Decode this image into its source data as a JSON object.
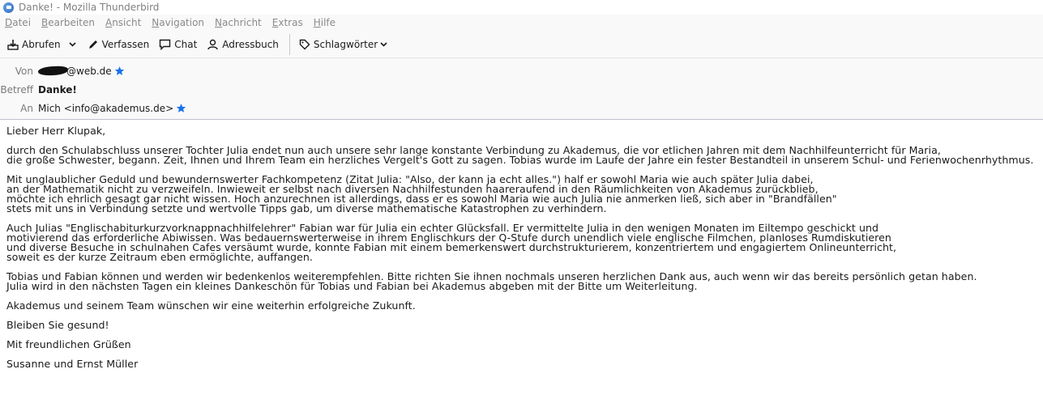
{
  "window": {
    "title": "Danke! - Mozilla Thunderbird"
  },
  "menu": {
    "items": [
      "Datei",
      "Bearbeiten",
      "Ansicht",
      "Navigation",
      "Nachricht",
      "Extras",
      "Hilfe"
    ]
  },
  "toolbar": {
    "get_mail_label": "Abrufen",
    "compose_label": "Verfassen",
    "chat_label": "Chat",
    "addressbook_label": "Adressbuch",
    "tags_label": "Schlagwörter"
  },
  "header": {
    "from_label": "Von",
    "from_value_visible": "@web.de",
    "subject_label": "Betreff",
    "subject_value": "Danke!",
    "to_label": "An",
    "to_value": "Mich <info@akademus.de>"
  },
  "colors": {
    "star": "#1a73e8",
    "text": "#1a1a1a",
    "label": "#7a7a7a"
  },
  "body": {
    "paragraphs": [
      [
        "Lieber Herr Klupak,"
      ],
      [
        "durch den Schulabschluss unserer Tochter Julia endet nun auch unsere sehr lange konstante Verbindung zu Akademus, die vor etlichen Jahren mit dem Nachhilfeunterricht für Maria,",
        "die große Schwester, begann. Zeit, Ihnen und Ihrem Team ein herzliches Vergelt's Gott zu sagen. Tobias wurde im Laufe der Jahre ein fester Bestandteil in unserem Schul- und Ferienwochenrhythmus."
      ],
      [
        "Mit unglaublicher Geduld und bewundernswerter Fachkompetenz (Zitat Julia: \"Also, der kann ja echt alles.\") half er sowohl Maria wie auch später Julia dabei,",
        "an der Mathematik nicht zu verzweifeln. Inwieweit er selbst nach diversen Nachhilfestunden haareraufend in den Räumlichkeiten von Akademus zurückblieb,",
        "möchte ich ehrlich gesagt gar nicht wissen. Hoch anzurechnen ist allerdings, dass er es sowohl Maria wie auch Julia nie anmerken ließ, sich aber in \"Brandfällen\"",
        "stets mit uns in Verbindung setzte und wertvolle Tipps gab, um diverse mathematische Katastrophen zu verhindern."
      ],
      [
        "Auch Julias \"Englischabiturkurzvorknappnachhilfelehrer\" Fabian war für Julia ein echter Glücksfall. Er vermittelte Julia in den wenigen Monaten im Eiltempo geschickt und",
        "motivierend das erforderliche Abiwissen. Was bedauernswerterweise in ihrem Englischkurs der Q-Stufe durch unendlich viele englische Filmchen, planloses Rumdiskutieren",
        "und diverse Besuche in schulnahen Cafes versäumt wurde, konnte Fabian mit einem bemerkenswert durchstrukturierem, konzentriertem und engagiertem Onlineunterricht,",
        "soweit es der kurze Zeitraum eben ermöglichte, auffangen."
      ],
      [
        "Tobias und Fabian können und werden wir bedenkenlos weiterempfehlen. Bitte richten Sie ihnen nochmals unseren herzlichen Dank aus, auch wenn wir das bereits persönlich getan haben.",
        "Julia wird in den nächsten Tagen ein kleines Dankeschön für Tobias und Fabian bei Akademus abgeben mit der Bitte um Weiterleitung."
      ],
      [
        "Akademus und seinem Team wünschen wir eine weiterhin erfolgreiche Zukunft."
      ],
      [
        "Bleiben Sie gesund!"
      ],
      [
        "Mit freundlichen Grüßen"
      ],
      [
        "Susanne und Ernst Müller"
      ]
    ]
  }
}
